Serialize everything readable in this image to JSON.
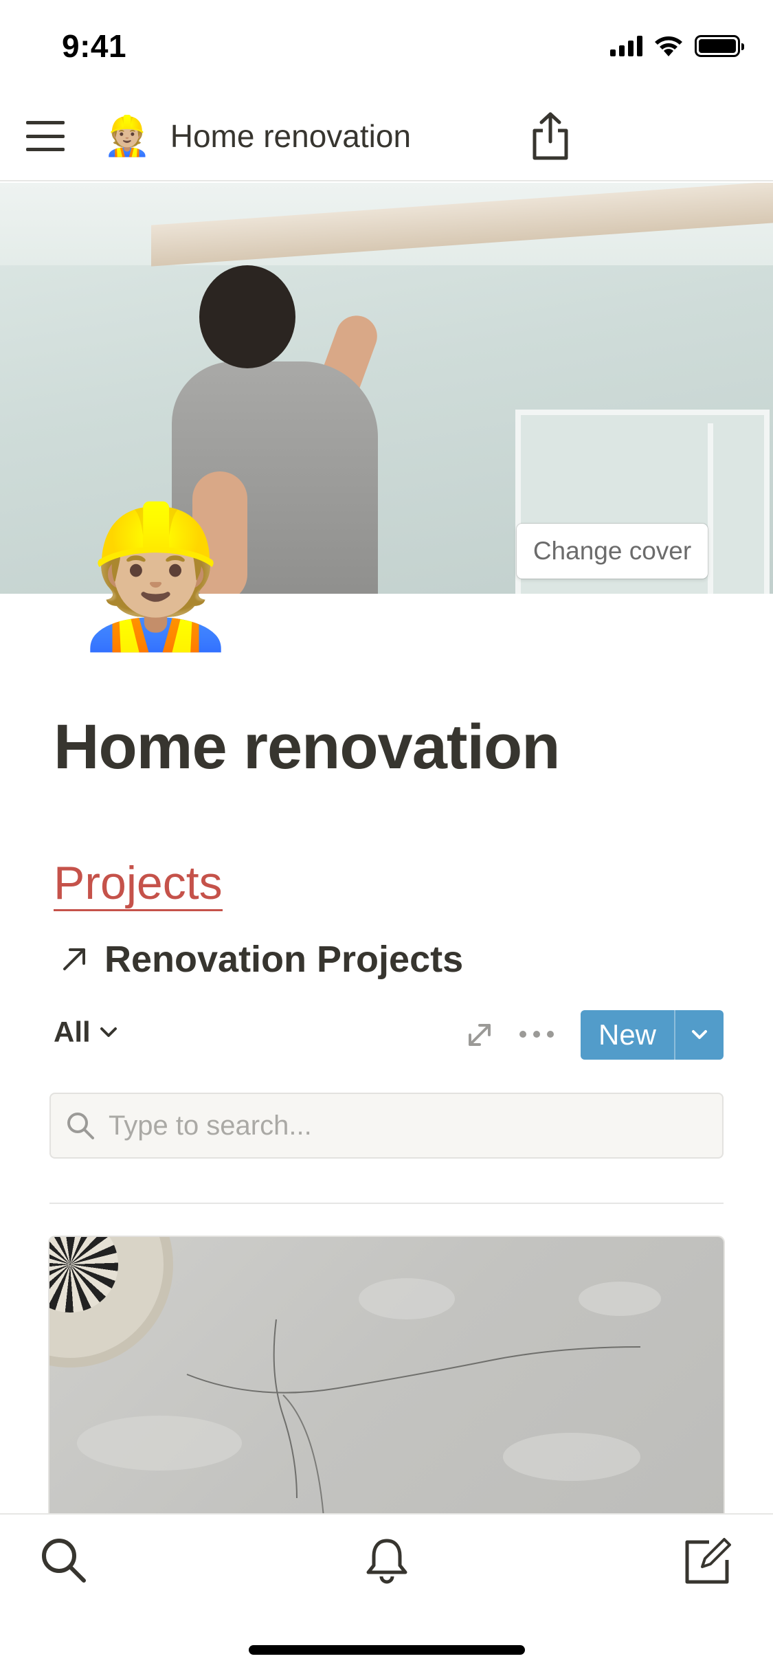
{
  "status_bar": {
    "time": "9:41"
  },
  "nav": {
    "page_emoji": "👷🏼",
    "title": "Home renovation"
  },
  "cover": {
    "change_cover_label": "Change cover"
  },
  "page": {
    "icon": "👷🏼",
    "title": "Home renovation"
  },
  "projects_link": "Projects",
  "database": {
    "title": "Renovation Projects",
    "view_label": "All",
    "new_label": "New",
    "search_placeholder": "Type to search..."
  },
  "colors": {
    "accent_red": "#c5524a",
    "button_blue": "#529cca",
    "text": "#37352f"
  },
  "icons": {
    "menu": "hamburger-icon",
    "share": "share-icon",
    "link_arrow": "arrow-up-right-icon",
    "expand": "expand-icon",
    "more": "more-icon",
    "chevron": "chevron-down-icon",
    "search": "search-icon",
    "tab_search": "search-icon",
    "tab_notifications": "bell-icon",
    "tab_compose": "compose-icon"
  }
}
